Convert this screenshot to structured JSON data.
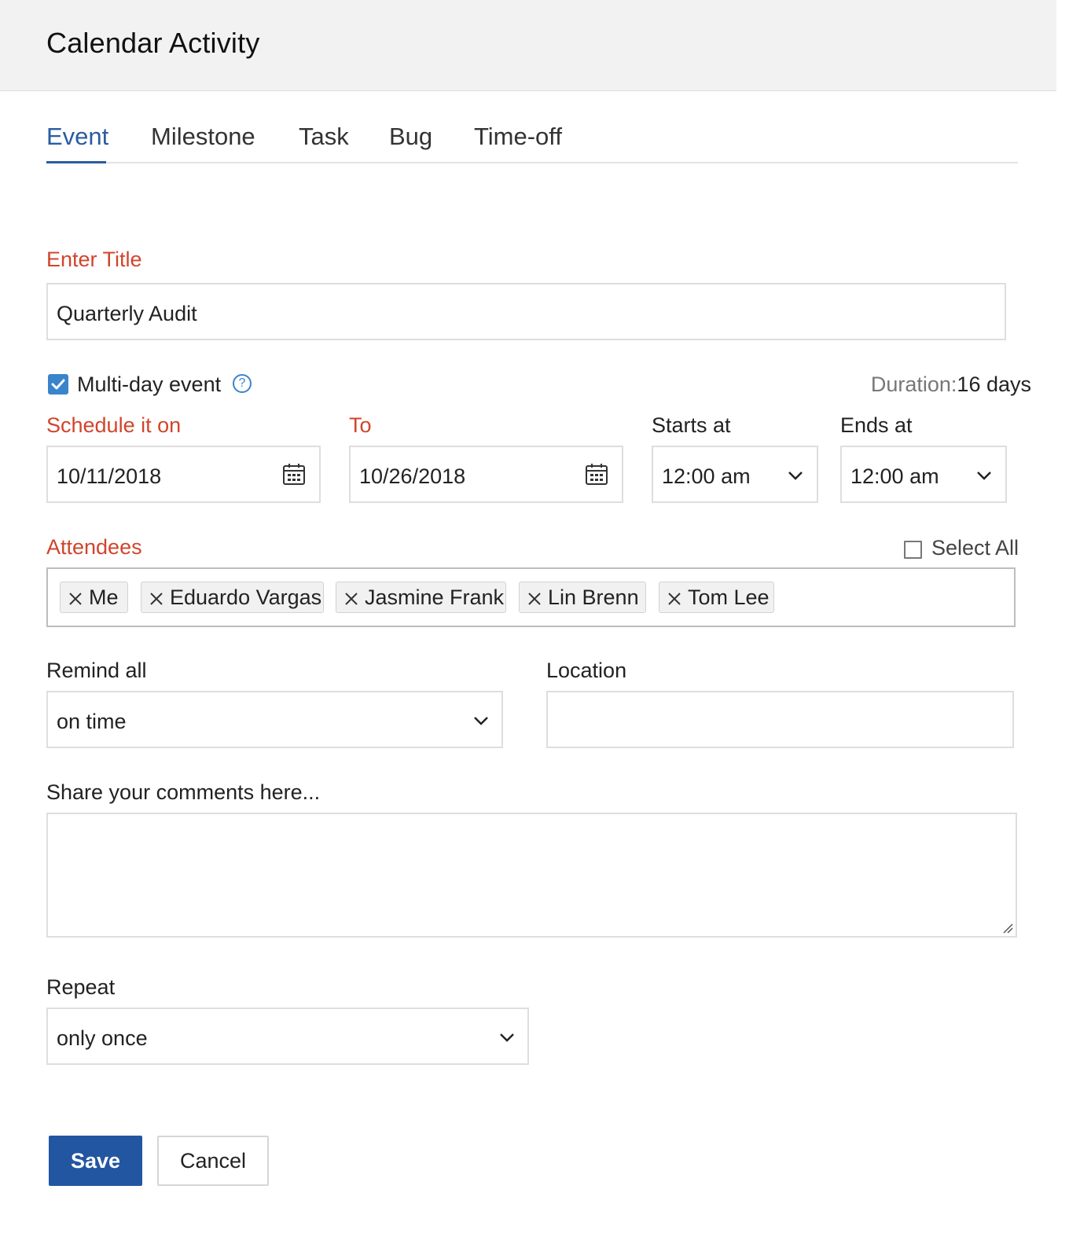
{
  "header": {
    "title": "Calendar Activity"
  },
  "tabs": [
    {
      "label": "Event",
      "active": true
    },
    {
      "label": "Milestone",
      "active": false
    },
    {
      "label": "Task",
      "active": false
    },
    {
      "label": "Bug",
      "active": false
    },
    {
      "label": "Time-off",
      "active": false
    }
  ],
  "title_field": {
    "label": "Enter Title",
    "value": "Quarterly Audit"
  },
  "multiday": {
    "label": "Multi-day event",
    "checked": true,
    "help_icon": "question-circle-icon"
  },
  "duration": {
    "label": "Duration:",
    "value": "16 days"
  },
  "schedule": {
    "from_label": "Schedule it on",
    "from_value": "10/11/2018",
    "to_label": "To",
    "to_value": "10/26/2018",
    "starts_label": "Starts at",
    "starts_value": "12:00 am",
    "ends_label": "Ends at",
    "ends_value": "12:00 am"
  },
  "attendees": {
    "label": "Attendees",
    "select_all_label": "Select All",
    "select_all_checked": false,
    "list": [
      "Me",
      "Eduardo Vargas",
      "Jasmine Frank",
      "Lin Brenn",
      "Tom Lee"
    ]
  },
  "remind": {
    "label": "Remind all",
    "value": "on time"
  },
  "location": {
    "label": "Location",
    "value": ""
  },
  "comments": {
    "label": "Share your comments here...",
    "value": ""
  },
  "repeat": {
    "label": "Repeat",
    "value": "only once"
  },
  "actions": {
    "save_label": "Save",
    "cancel_label": "Cancel"
  },
  "colors": {
    "accent": "#2a5da0",
    "required": "#d0452c",
    "checkbox": "#3a84cc",
    "save_button": "#2356a0"
  }
}
